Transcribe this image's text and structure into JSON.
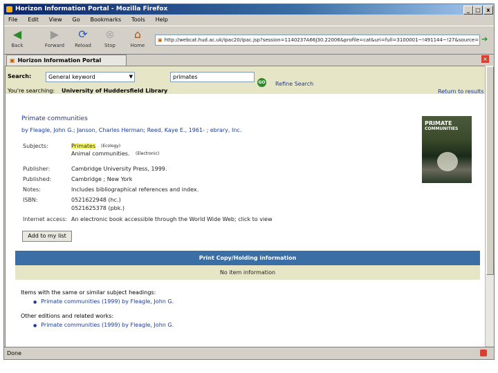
{
  "window": {
    "title": "Horizon Information Portal - Mozilla Firefox",
    "min": "_",
    "max": "□",
    "close": "x"
  },
  "menu": [
    "File",
    "Edit",
    "View",
    "Go",
    "Bookmarks",
    "Tools",
    "Help"
  ],
  "toolbar": {
    "back": "Back",
    "forward": "Forward",
    "reload": "Reload",
    "stop": "Stop",
    "home": "Home",
    "url": "http://webcat.hud.ac.uk/ipac20/ipac.jsp?session=1140237A66J30.22006&profile=cat&uri=full=3100001~!491144~!27&source="
  },
  "tab": {
    "label": "Horizon Information Portal"
  },
  "search": {
    "label": "Search:",
    "type": "General keyword",
    "query": "primates",
    "go": "GO",
    "refine": "Refine Search"
  },
  "scope": {
    "prefix": "You're searching:",
    "library": "University of Huddersfield Library",
    "return": "Return to results"
  },
  "record": {
    "title": "Primate communities",
    "authors": "by Fleagle, John G.; Janson, Charles Herman; Reed, Kaye E., 1961- ; ebrary, Inc.",
    "cover_line1": "PRIMATE",
    "cover_line2": "COMMUNITIES",
    "subjects_label": "Subjects:",
    "subject1": "Primates",
    "subject1_note": "(Ecology)",
    "subject2": "Animal communities.",
    "subject2_note": "(Electronic)",
    "publisher_label": "Publisher:",
    "publisher": "Cambridge University Press, 1999.",
    "published_label": "Published:",
    "published": "Cambridge ; New York",
    "notes_label": "Notes:",
    "notes": "Includes bibliographical references and index.",
    "isbn_label": "ISBN:",
    "isbn1": "0521622948 (hc.)",
    "isbn2": "0521625378 (pbk.)",
    "internet_label": "Internet access:",
    "internet": "An electronic book accessible through the World Wide Web; click to view",
    "add_button": "Add to my list"
  },
  "holdings": {
    "header": "Print Copy/Holding information",
    "none": "No item information"
  },
  "related": {
    "same_subject_heading": "Items with the same or similar subject headings:",
    "same_subject_item": "Primate communities (1999) by Fleagle, John G.",
    "other_editions_heading": "Other editions and related works:",
    "other_editions_item": "Primate communities (1999) by Fleagle, John G."
  },
  "status": {
    "text": "Done"
  },
  "colors": {
    "holdings_header": "#3a6ea5",
    "holdings_body": "#e6e5c5",
    "link": "#1a3a9a"
  }
}
